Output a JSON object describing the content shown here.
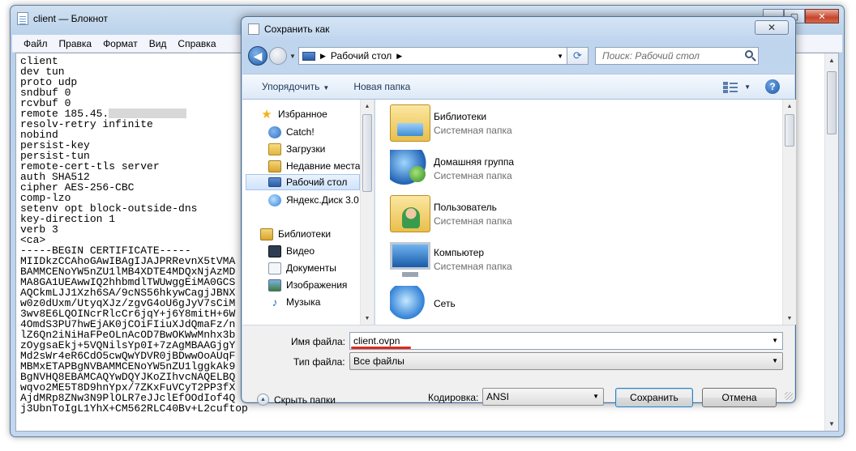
{
  "notepad": {
    "title": "client — Блокнот",
    "menu": [
      "Файл",
      "Правка",
      "Формат",
      "Вид",
      "Справка"
    ],
    "lines": [
      "client",
      "dev tun",
      "proto udp",
      "sndbuf 0",
      "rcvbuf 0",
      "remote 185.45.",
      "resolv-retry infinite",
      "nobind",
      "persist-key",
      "persist-tun",
      "remote-cert-tls server",
      "auth SHA512",
      "cipher AES-256-CBC",
      "comp-lzo",
      "setenv opt block-outside-dns",
      "key-direction 1",
      "verb 3",
      "<ca>",
      "-----BEGIN CERTIFICATE-----",
      "MIIDkzCCAhoGAwIBAgIJAJPRRevnX5tVMA",
      "BAMMCENoYW5nZU1lMB4XDTE4MDQxNjAzMD",
      "MA8GA1UEAwwIQ2hhbmdlTWUwggEiMA0GCS",
      "AQCkmLJJ1Xzh6SA/9cNS56hkywCagjJBNX",
      "w0z0dUxm/UtyqXJz/zgvG4oU6gJyV7sCiM",
      "3wv8E6LQOINcrRlcCr6jqY+j6Y8mitH+6W",
      "4OmdS3PU7hwEjAK0jCOiFIiuXJdQmaFz/n",
      "lZ6Qn2iNiHaFPeOLnAcOD7BwOKWwMnhx3b",
      "zOygsaEkj+5VQNilsYp0I+7zAgMBAAGjgY",
      "Md2sWr4eR6CdO5cwQwYDVR0jBDwwOoAUqF",
      "MBMxETAPBgNVBAMMCENoYW5nZU1lggkAk9",
      "BgNVHQ8EBAMCAQYwDQYJKoZIhvcNAQELBQ",
      "wqvo2ME5T8D9hnYpx/7ZKxFuVCyT2PP3fX",
      "AjdMRp8ZNw3N9PlOLR7eJJclEfOOdIof4Q",
      "j3UbnToIgL1YhX+CM562RLC40Bv+L2cuftop"
    ]
  },
  "dialog": {
    "title": "Сохранить как",
    "close_glyph": "✕",
    "address": "Рабочий стол",
    "search_placeholder": "Поиск: Рабочий стол",
    "toolbar": {
      "organize": "Упорядочить",
      "new_folder": "Новая папка"
    },
    "nav": [
      {
        "label": "Избранное"
      },
      {
        "label": "Catch!"
      },
      {
        "label": "Загрузки"
      },
      {
        "label": "Недавние места"
      },
      {
        "label": "Рабочий стол"
      },
      {
        "label": "Яндекс.Диск 3.0"
      },
      {
        "label": "Библиотеки"
      },
      {
        "label": "Видео"
      },
      {
        "label": "Документы"
      },
      {
        "label": "Изображения"
      },
      {
        "label": "Музыка"
      }
    ],
    "files": [
      {
        "name": "Библиотеки",
        "type": "Системная папка"
      },
      {
        "name": "Домашняя группа",
        "type": "Системная папка"
      },
      {
        "name": "Пользователь",
        "type": "Системная папка"
      },
      {
        "name": "Компьютер",
        "type": "Системная папка"
      },
      {
        "name": "Сеть",
        "type": ""
      }
    ],
    "filename_label": "Имя файла:",
    "filename_value": "client.ovpn",
    "filetype_label": "Тип файла:",
    "filetype_value": "Все файлы",
    "hide_folders": "Скрыть папки",
    "encoding_label": "Кодировка:",
    "encoding_value": "ANSI",
    "save_label": "Сохранить",
    "cancel_label": "Отмена",
    "accent_color": "#e0281e"
  }
}
